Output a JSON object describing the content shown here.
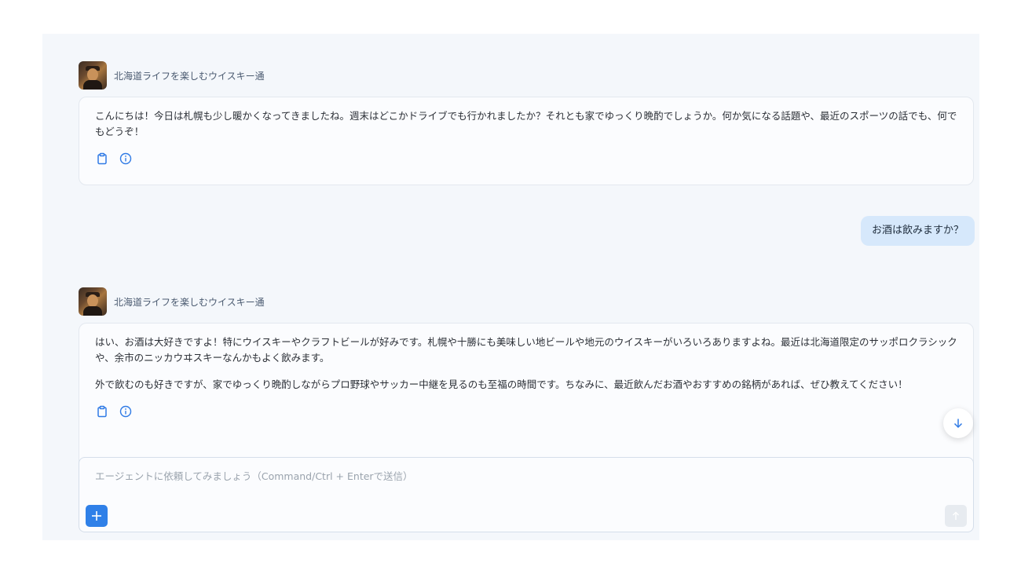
{
  "agent": {
    "name": "北海道ライフを楽しむウイスキー通"
  },
  "messages": [
    {
      "role": "agent",
      "paragraphs": [
        "こんにちは！今日は札幌も少し暖かくなってきましたね。週末はどこかドライブでも行かれましたか？それとも家でゆっくり晩酌でしょうか。何か気になる話題や、最近のスポーツの話でも、何でもどうぞ！"
      ]
    },
    {
      "role": "user",
      "text": "お酒は飲みますか？"
    },
    {
      "role": "agent",
      "paragraphs": [
        "はい、お酒は大好きですよ！特にウイスキーやクラフトビールが好みです。札幌や十勝にも美味しい地ビールや地元のウイスキーがいろいろありますよね。最近は北海道限定のサッポロクラシックや、余市のニッカウヰスキーなんかもよく飲みます。",
        "外で飲むのも好きですが、家でゆっくり晩酌しながらプロ野球やサッカー中継を見るのも至福の時間です。ちなみに、最近飲んだお酒やおすすめの銘柄があれば、ぜひ教えてください！"
      ]
    }
  ],
  "message_actions": [
    "clipboard-icon",
    "info-icon"
  ],
  "composer": {
    "placeholder": "エージェントに依頼してみましょう（Command/Ctrl + Enterで送信）",
    "value": ""
  },
  "colors": {
    "panel_bg": "#f4f7fb",
    "user_bubble": "#d6e8fb",
    "accent": "#2f80e8",
    "agent_name": "#4a5a70"
  }
}
